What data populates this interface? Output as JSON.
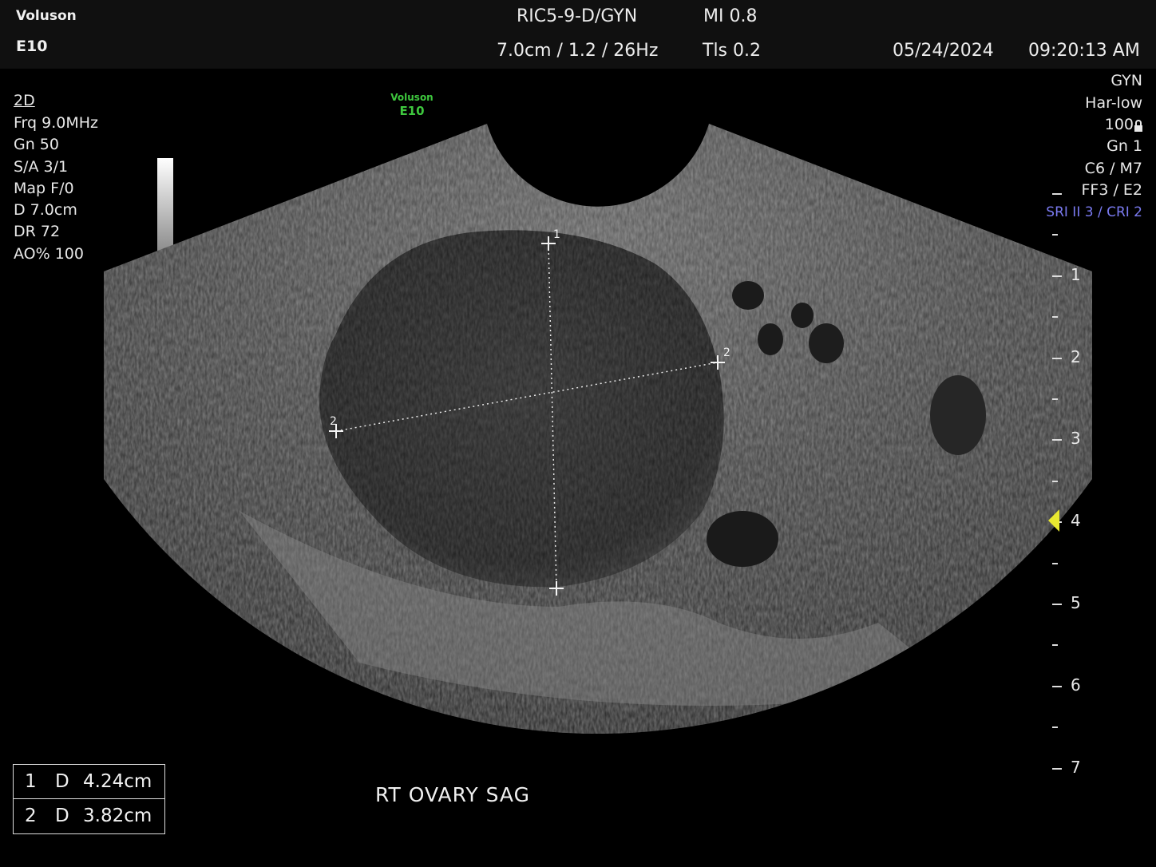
{
  "header": {
    "brand_line1": "Voluson",
    "brand_line2": "E10",
    "probe_preset": "RIC5-9-D/GYN",
    "mi": "MI  0.8",
    "depth_zoom_rate": "7.0cm / 1.2 / 26Hz",
    "tis": "Tls  0.2",
    "date": "05/24/2024",
    "time": "09:20:13 AM"
  },
  "left_params": {
    "mode": "2D",
    "frq": "Frq  9.0MHz",
    "gn": "Gn   50",
    "sa": "S/A  3/1",
    "map": "Map  F/0",
    "d": "D    7.0cm",
    "dr": "DR  72",
    "ao": "AO%  100"
  },
  "right_params": {
    "app": "GYN",
    "harmonic": "Har-low",
    "power": "100",
    "gn": "Gn   1",
    "c_m": "C6 / M7",
    "ff_e": "FF3 / E2",
    "sri_cri": "SRI II 3 / CRI 2"
  },
  "watermark": {
    "line1": "Voluson",
    "line2": "E10",
    "color": "#3ec83e"
  },
  "depth_scale": {
    "labels": [
      "1",
      "2",
      "3",
      "4",
      "5",
      "6",
      "7"
    ],
    "unit": "cm",
    "focus_depth": 4
  },
  "calipers": {
    "c1_label": "1",
    "c2_label": "2"
  },
  "measurements": [
    {
      "index": "1",
      "type": "D",
      "value": "4.24cm"
    },
    {
      "index": "2",
      "type": "D",
      "value": "3.82cm"
    }
  ],
  "annotation": "RT  OVARY  SAG",
  "icons": {
    "lock": "lock-icon",
    "focus": "focus-marker-icon",
    "grayscale": "grayscale-bar"
  }
}
